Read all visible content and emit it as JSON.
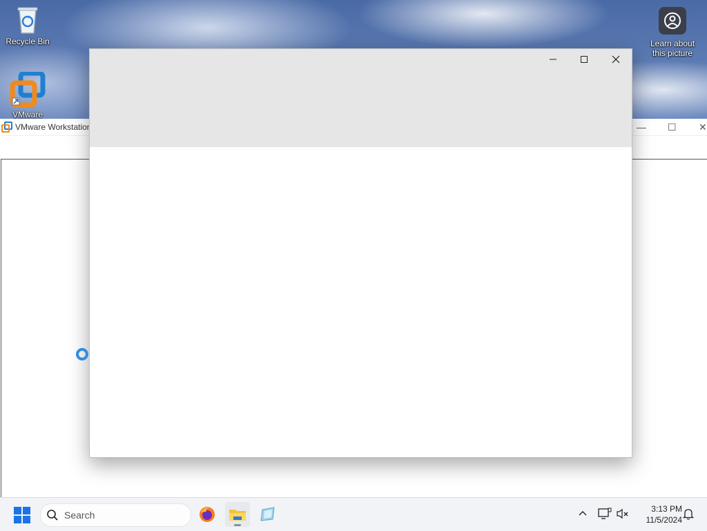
{
  "desktop": {
    "icons": [
      {
        "label": "Recycle Bin",
        "icon": "recycle-bin-icon"
      },
      {
        "label": "VMware",
        "icon": "vmware-icon"
      }
    ],
    "spotlight_label": "Learn about this picture"
  },
  "background_window": {
    "title": "VMware Workstation"
  },
  "foreground_window": {
    "controls": [
      "minimize",
      "maximize",
      "close"
    ]
  },
  "taskbar": {
    "search_placeholder": "Search",
    "apps": [
      "firefox-icon",
      "file-explorer-icon",
      "vmware-workstation-icon"
    ],
    "clock": {
      "time": "3:13 PM",
      "date": "11/5/2024"
    }
  },
  "colors": {
    "window_header": "#e6e6e6",
    "taskbar": "#f1f3f6",
    "start_blue": "#1a73e8"
  }
}
